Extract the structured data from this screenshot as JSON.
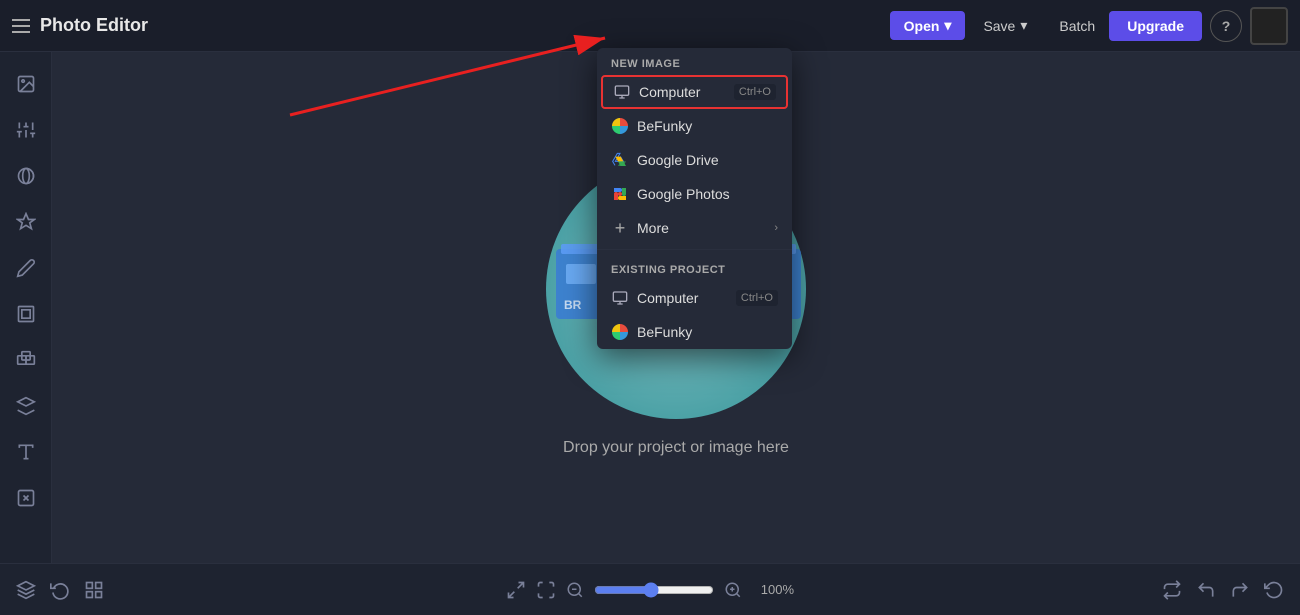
{
  "app": {
    "title": "Photo Editor"
  },
  "topbar": {
    "open_label": "Open",
    "save_label": "Save",
    "batch_label": "Batch",
    "upgrade_label": "Upgrade",
    "help_label": "?"
  },
  "dropdown": {
    "new_image_label": "New Image",
    "existing_project_label": "Existing Project",
    "items_new": [
      {
        "id": "computer-new",
        "icon": "computer",
        "label": "Computer",
        "shortcut": "Ctrl+O",
        "highlighted": true
      },
      {
        "id": "befunky-new",
        "icon": "befunky",
        "label": "BeFunky",
        "shortcut": ""
      },
      {
        "id": "googledrive-new",
        "icon": "googledrive",
        "label": "Google Drive",
        "shortcut": ""
      },
      {
        "id": "googlephotos-new",
        "icon": "googlephotos",
        "label": "Google Photos",
        "shortcut": ""
      },
      {
        "id": "more-new",
        "icon": "more",
        "label": "More",
        "shortcut": ""
      }
    ],
    "items_existing": [
      {
        "id": "computer-existing",
        "icon": "computer",
        "label": "Computer",
        "shortcut": "Ctrl+O"
      },
      {
        "id": "befunky-existing",
        "icon": "befunky",
        "label": "BeFunky",
        "shortcut": ""
      }
    ]
  },
  "canvas": {
    "drop_text": "Drop your project or image here"
  },
  "bottombar": {
    "zoom_value": "100%"
  }
}
